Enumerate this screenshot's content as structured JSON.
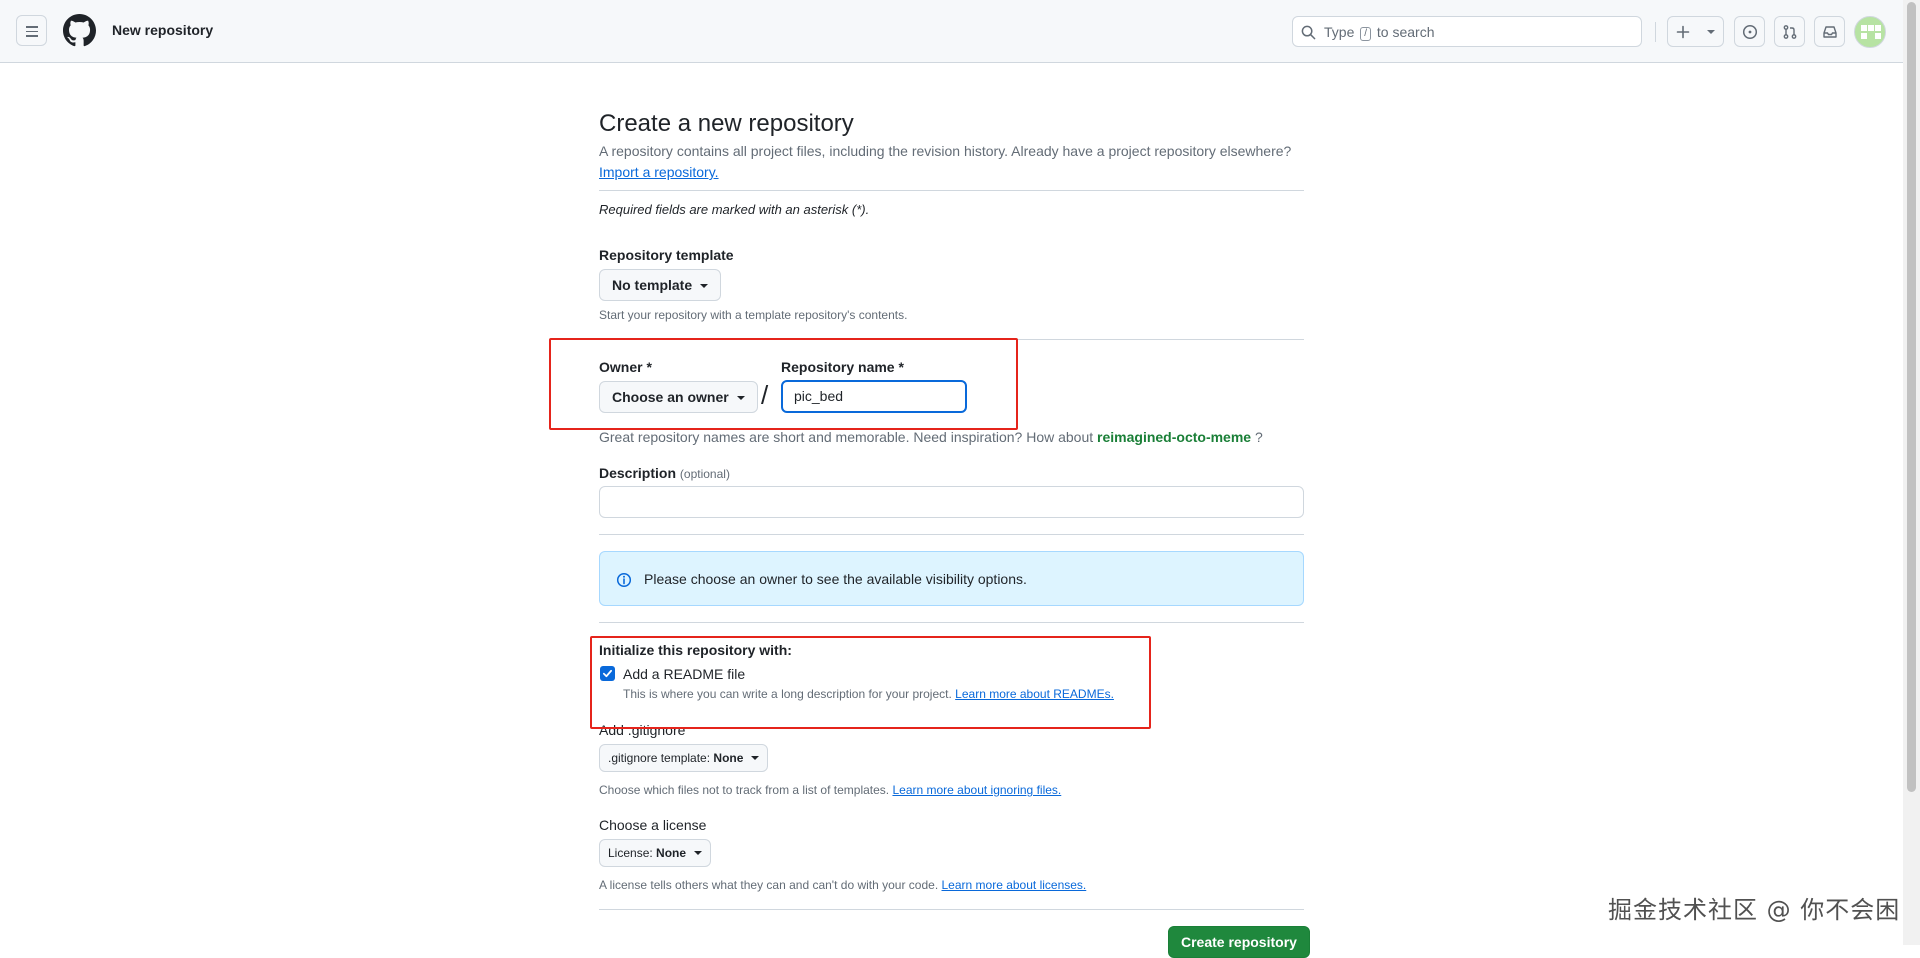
{
  "header": {
    "page_context": "New repository",
    "search": {
      "before_key": "Type",
      "key": "/",
      "after_key": "to search"
    }
  },
  "page": {
    "title": "Create a new repository",
    "subtitle": "A repository contains all project files, including the revision history. Already have a project repository elsewhere?",
    "import_link": "Import a repository.",
    "required_note": "Required fields are marked with an asterisk (*)."
  },
  "template": {
    "label": "Repository template",
    "button": "No template",
    "note": "Start your repository with a template repository's contents."
  },
  "owner": {
    "label": "Owner *",
    "button": "Choose an owner",
    "separator": "/"
  },
  "repo_name": {
    "label": "Repository name *",
    "value": "pic_bed"
  },
  "suggestion": {
    "prefix": "Great repository names are short and memorable. Need inspiration? How about",
    "name": "reimagined-octo-meme",
    "suffix": "?"
  },
  "description": {
    "label": "Description",
    "optional": "(optional)",
    "value": ""
  },
  "visibility_notice": "Please choose an owner to see the available visibility options.",
  "initialize": {
    "heading": "Initialize this repository with:",
    "readme_label": "Add a README file",
    "readme_checked": true,
    "readme_note": "This is where you can write a long description for your project.",
    "readme_link": "Learn more about READMEs."
  },
  "gitignore": {
    "label": "Add .gitignore",
    "prefix": ".gitignore template:",
    "value": "None",
    "note": "Choose which files not to track from a list of templates.",
    "link": "Learn more about ignoring files."
  },
  "license": {
    "label": "Choose a license",
    "prefix": "License:",
    "value": "None",
    "note": "A license tells others what they can and can't do with your code.",
    "link": "Learn more about licenses."
  },
  "submit": {
    "label": "Create repository"
  },
  "watermark": "掘金技术社区 @ 你不会困",
  "colors": {
    "accent": "#0969da",
    "primary_button": "#1f883d",
    "suggestion_green": "#1a7f37",
    "highlight_red": "#e5241b",
    "info_bg": "#ddf4ff"
  },
  "icons": [
    "hamburger-icon",
    "github-logo-icon",
    "search-icon",
    "plus-icon",
    "issues-icon",
    "pull-requests-icon",
    "inbox-icon",
    "info-icon",
    "check-icon"
  ]
}
